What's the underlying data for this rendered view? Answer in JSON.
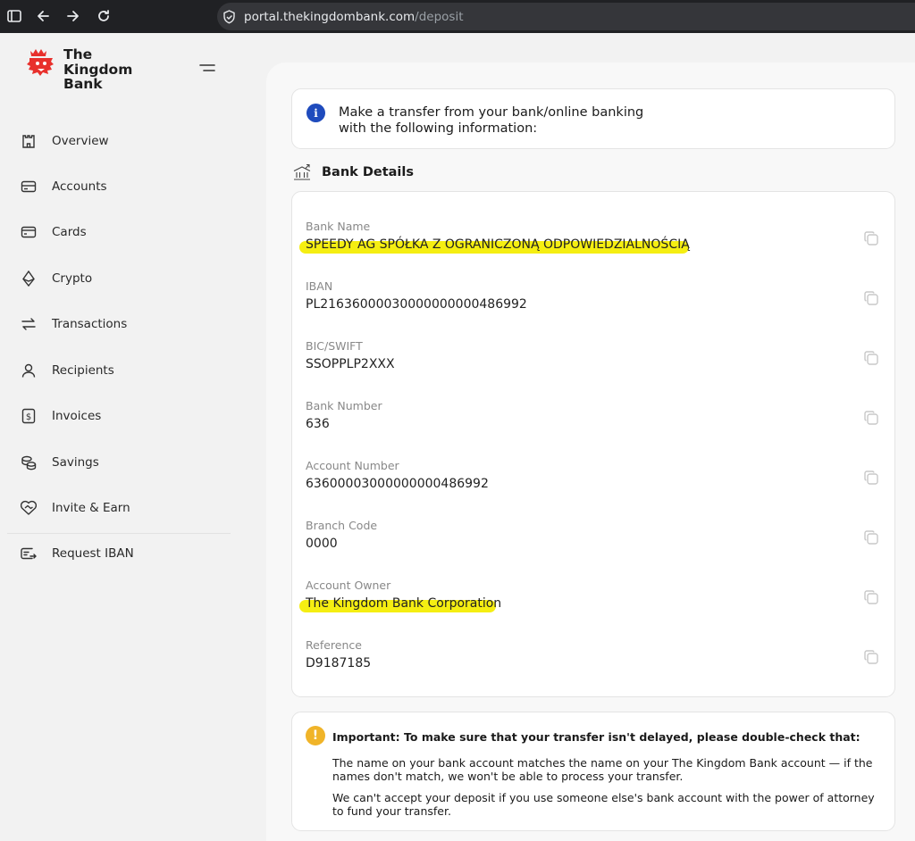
{
  "browser": {
    "url_host": "portal.thekingdombank.com",
    "url_path": "/deposit"
  },
  "brand": {
    "line1": "The",
    "line2": "Kingdom",
    "line3": "Bank",
    "accent": "#e8302c"
  },
  "nav": [
    {
      "label": "Overview",
      "icon": "castle-icon"
    },
    {
      "label": "Accounts",
      "icon": "wallet-icon"
    },
    {
      "label": "Cards",
      "icon": "card-icon"
    },
    {
      "label": "Crypto",
      "icon": "ethereum-icon"
    },
    {
      "label": "Transactions",
      "icon": "transfer-arrows-icon"
    },
    {
      "label": "Recipients",
      "icon": "user-icon"
    },
    {
      "label": "Invoices",
      "icon": "invoice-icon"
    },
    {
      "label": "Savings",
      "icon": "coins-icon"
    },
    {
      "label": "Invite & Earn",
      "icon": "heart-handshake-icon"
    },
    {
      "label": "Request IBAN",
      "icon": "request-iban-icon"
    }
  ],
  "info": {
    "line1": "Make a transfer from your bank/online banking",
    "line2": "with the following information:"
  },
  "section_title": "Bank Details",
  "details": [
    {
      "label": "Bank Name",
      "value": "SPEEDY AG SPÓŁKA Z OGRANICZONĄ ODPOWIEDZIALNOŚCIĄ",
      "highlighted": true
    },
    {
      "label": "IBAN",
      "value": "PL21636000030000000000486992",
      "highlighted": false
    },
    {
      "label": "BIC/SWIFT",
      "value": "SSOPPLP2XXX",
      "highlighted": false
    },
    {
      "label": "Bank Number",
      "value": "636",
      "highlighted": false
    },
    {
      "label": "Account Number",
      "value": "63600003000000000486992",
      "highlighted": false
    },
    {
      "label": "Branch Code",
      "value": "0000",
      "highlighted": false
    },
    {
      "label": "Account Owner",
      "value": "The Kingdom Bank Corporation",
      "highlighted": true
    },
    {
      "label": "Reference",
      "value": "D9187185",
      "highlighted": false
    }
  ],
  "important": {
    "title": "Important: To make sure that your transfer isn't delayed, please double-check that:",
    "p1": "The name on your bank account matches the name on your The Kingdom Bank account — if the names don't match, we won't be able to process your transfer.",
    "p2": "We can't accept your deposit if you use someone else's bank account with the power of attorney to fund your transfer."
  },
  "colors": {
    "info_dot": "#1f4bbd",
    "warn_dot": "#f0b429",
    "highlight": "#f5ee12"
  }
}
